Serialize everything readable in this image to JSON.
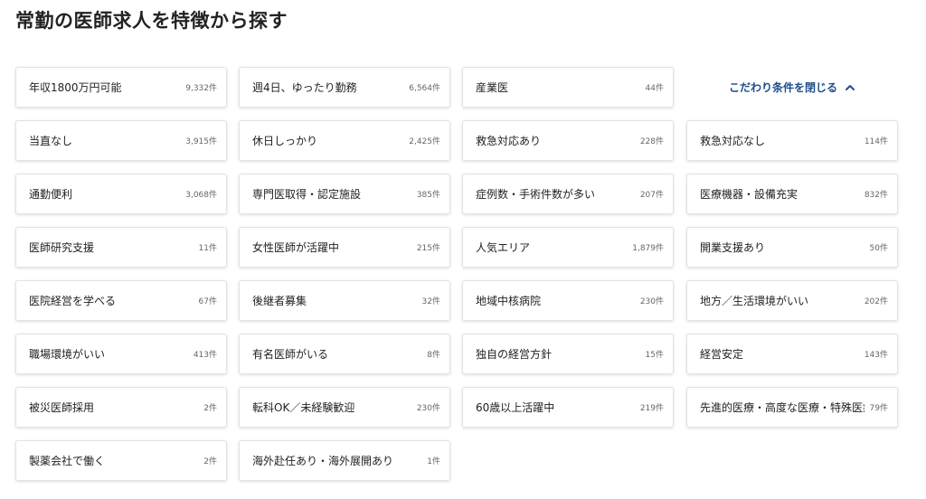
{
  "page_title": "常勤の医師求人を特徴から探す",
  "toggle": {
    "label": "こだわり条件を閉じる",
    "icon": "chevron-up-icon",
    "color": "#1f4e8c"
  },
  "features": [
    {
      "label": "年収1800万円可能",
      "count": "9,332件"
    },
    {
      "label": "週4日、ゆったり勤務",
      "count": "6,564件"
    },
    {
      "label": "産業医",
      "count": "44件"
    },
    {
      "label": "当直なし",
      "count": "3,915件"
    },
    {
      "label": "休日しっかり",
      "count": "2,425件"
    },
    {
      "label": "救急対応あり",
      "count": "228件"
    },
    {
      "label": "救急対応なし",
      "count": "114件"
    },
    {
      "label": "通勤便利",
      "count": "3,068件"
    },
    {
      "label": "専門医取得・認定施設",
      "count": "385件"
    },
    {
      "label": "症例数・手術件数が多い",
      "count": "207件"
    },
    {
      "label": "医療機器・設備充実",
      "count": "832件"
    },
    {
      "label": "医師研究支援",
      "count": "11件"
    },
    {
      "label": "女性医師が活躍中",
      "count": "215件"
    },
    {
      "label": "人気エリア",
      "count": "1,879件"
    },
    {
      "label": "開業支援あり",
      "count": "50件"
    },
    {
      "label": "医院経営を学べる",
      "count": "67件"
    },
    {
      "label": "後継者募集",
      "count": "32件"
    },
    {
      "label": "地域中核病院",
      "count": "230件"
    },
    {
      "label": "地方／生活環境がいい",
      "count": "202件"
    },
    {
      "label": "職場環境がいい",
      "count": "413件"
    },
    {
      "label": "有名医師がいる",
      "count": "8件"
    },
    {
      "label": "独自の経営方針",
      "count": "15件"
    },
    {
      "label": "経営安定",
      "count": "143件"
    },
    {
      "label": "被災医師採用",
      "count": "2件"
    },
    {
      "label": "転科OK／未経験歓迎",
      "count": "230件"
    },
    {
      "label": "60歳以上活躍中",
      "count": "219件"
    },
    {
      "label": "先進的医療・高度な医療・特殊医療",
      "count": "79件"
    },
    {
      "label": "製薬会社で働く",
      "count": "2件"
    },
    {
      "label": "海外赴任あり・海外展開あり",
      "count": "1件"
    }
  ]
}
